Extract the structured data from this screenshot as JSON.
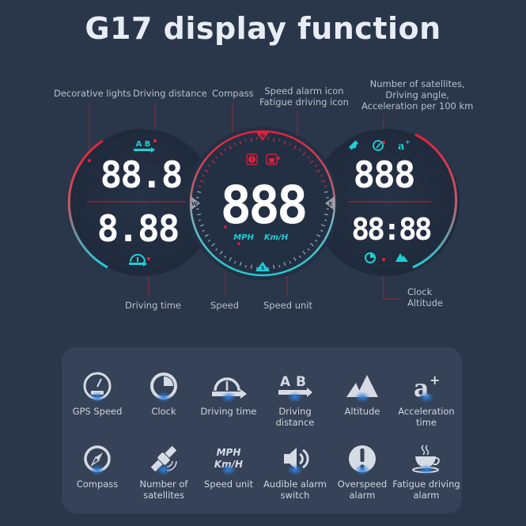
{
  "title": "G17 display function",
  "annotations": {
    "decorative_lights": "Decorative lights",
    "driving_distance": "Driving distance",
    "compass": "Compass",
    "speed_alarm_line1": "Speed alarm icon",
    "speed_alarm_line2": "Fatigue driving icon",
    "satellites_line1": "Number of satellites,",
    "satellites_line2": "Driving angle,",
    "satellites_line3": "Acceleration per 100 km",
    "driving_time": "Driving time",
    "speed": "Speed",
    "speed_unit": "Speed unit",
    "clock_line1": "Clock",
    "altitude_line2": "Altitude"
  },
  "display": {
    "left_top_digits": "88.8",
    "left_bottom_digits": "8.88",
    "center_digits": "888",
    "right_top_digits": "888",
    "right_bottom_digits": "88:88",
    "unit_mph": "MPH",
    "unit_kmh": "Km/H",
    "compass_n": "N",
    "compass_s": "S",
    "compass_e": "E",
    "compass_w": "W",
    "ab_icon_text": "A B"
  },
  "colors": {
    "background": "#2a3649",
    "panel": "#354257",
    "accent_red": "#e5203a",
    "accent_cyan": "#1ecfd6",
    "digit_white": "#ffffff"
  },
  "features": [
    {
      "icon": "gps-speed-icon",
      "label": "GPS Speed"
    },
    {
      "icon": "clock-icon",
      "label": "Clock"
    },
    {
      "icon": "driving-time-icon",
      "label": "Driving time"
    },
    {
      "icon": "driving-distance-icon",
      "label": "Driving distance"
    },
    {
      "icon": "altitude-icon",
      "label": "Altitude"
    },
    {
      "icon": "acceleration-icon",
      "label": "Acceleration time"
    },
    {
      "icon": "compass-icon",
      "label": "Compass"
    },
    {
      "icon": "satellite-icon",
      "label": "Number of satellites"
    },
    {
      "icon": "speed-unit-icon",
      "label": "Speed unit",
      "mph": "MPH",
      "kmh": "Km/H"
    },
    {
      "icon": "speaker-icon",
      "label": "Audible alarm switch"
    },
    {
      "icon": "overspeed-icon",
      "label": "Overspeed alarm"
    },
    {
      "icon": "coffee-cup-icon",
      "label": "Fatigue driving alarm"
    }
  ]
}
